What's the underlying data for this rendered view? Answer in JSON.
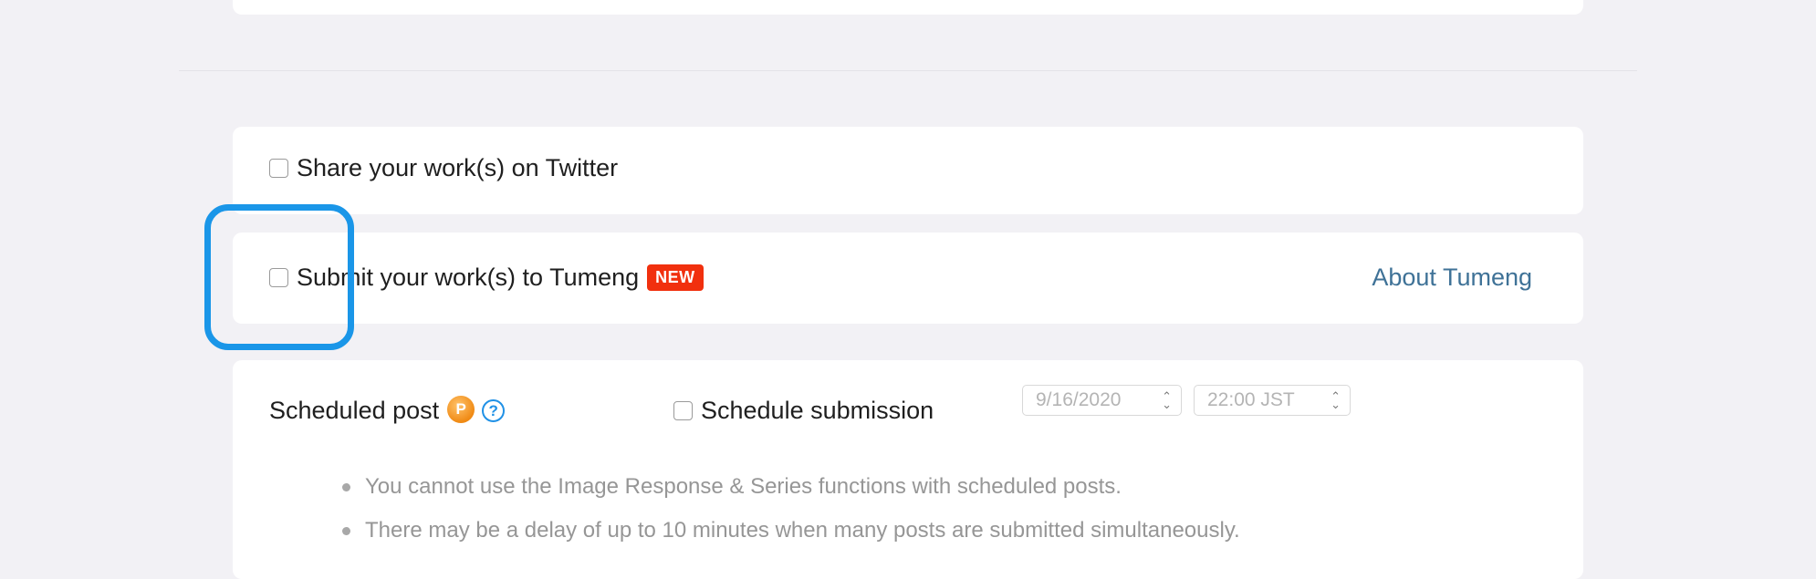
{
  "twitter": {
    "label": "Share your work(s) on Twitter",
    "checked": false
  },
  "tumeng": {
    "label": "Submit your work(s) to Tumeng",
    "badge": "NEW",
    "about_link": "About Tumeng",
    "checked": false
  },
  "scheduled": {
    "title": "Scheduled post",
    "premium_icon": "P",
    "help_icon": "?",
    "schedule_label": "Schedule submission",
    "schedule_checked": false,
    "date_value": "9/16/2020",
    "time_value": "22:00 JST",
    "notes": [
      "You cannot use the Image Response & Series functions with scheduled posts.",
      "There may be a delay of up to 10 minutes when many posts are submitted simultaneously."
    ]
  },
  "colors": {
    "page_bg": "#f2f1f5",
    "card_bg": "#ffffff",
    "new_badge": "#f1300e",
    "link": "#3f7297",
    "highlight": "#1a96e8",
    "help": "#2091e6"
  },
  "icons": {
    "premium": "premium-p-icon",
    "help": "help-question-icon",
    "spinner": "up-down-chevron-icon"
  }
}
